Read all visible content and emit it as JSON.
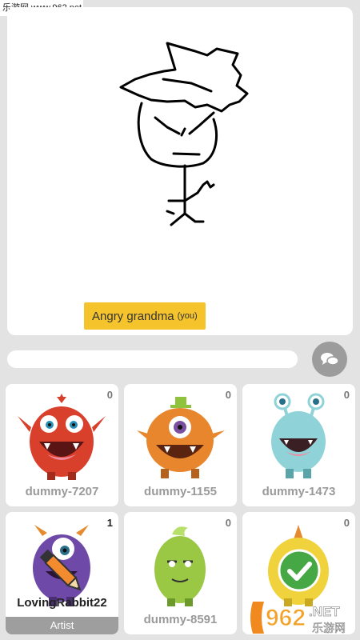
{
  "watermark_top": "乐游网 www.962.net",
  "drawing": {
    "word": "Angry grandma",
    "owner_tag": "(you)"
  },
  "chat": {
    "input_value": "",
    "button_icon": "chat-bubbles-icon"
  },
  "players": [
    {
      "name": "dummy-7207",
      "score": "0",
      "color": "#d9402b",
      "role": ""
    },
    {
      "name": "dummy-1155",
      "score": "0",
      "color": "#e8862d",
      "role": ""
    },
    {
      "name": "dummy-1473",
      "score": "0",
      "color": "#8fd3d8",
      "role": ""
    },
    {
      "name": "LovingRabbit22",
      "score": "1",
      "color": "#6f49a8",
      "role": "Artist"
    },
    {
      "name": "dummy-8591",
      "score": "0",
      "color": "#9ac845",
      "role": ""
    },
    {
      "name": "",
      "score": "0",
      "color": "#f0d23c",
      "role": "",
      "guessed": true
    }
  ],
  "watermark_bottom": {
    "number": "962",
    "suffix": ".NET",
    "chinese": "乐游网"
  }
}
